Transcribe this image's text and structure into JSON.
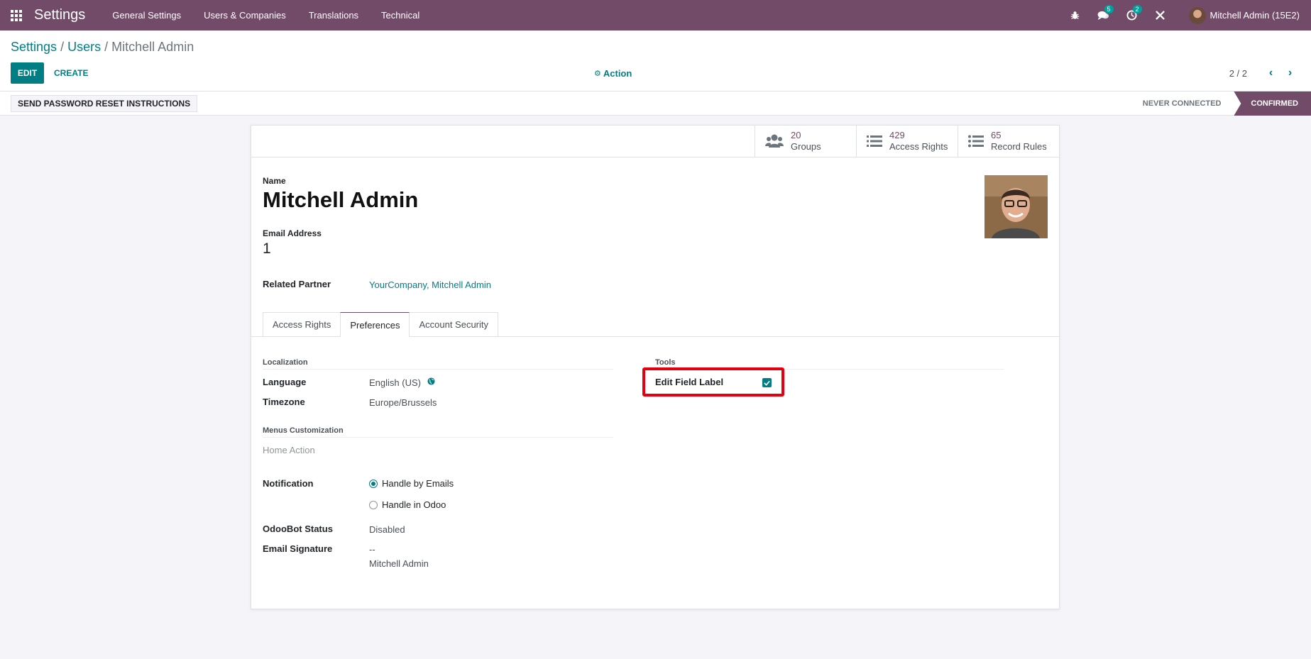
{
  "navbar": {
    "brand": "Settings",
    "menu": [
      "General Settings",
      "Users & Companies",
      "Translations",
      "Technical"
    ],
    "messages_badge": "5",
    "activities_badge": "2",
    "user_name": "Mitchell Admin (15E2)"
  },
  "breadcrumb": {
    "root": "Settings",
    "users": "Users",
    "current": "Mitchell Admin",
    "sep": "/"
  },
  "toolbar": {
    "edit_label": "EDIT",
    "create_label": "CREATE",
    "action_label": "Action"
  },
  "pager": {
    "value": "2 / 2"
  },
  "statusbar": {
    "reset_label": "SEND PASSWORD RESET INSTRUCTIONS",
    "stages": [
      "NEVER CONNECTED",
      "CONFIRMED"
    ]
  },
  "stat_buttons": [
    {
      "value": "20",
      "label": "Groups"
    },
    {
      "value": "429",
      "label": "Access Rights"
    },
    {
      "value": "65",
      "label": "Record Rules"
    }
  ],
  "form": {
    "name_label": "Name",
    "name_value": "Mitchell Admin",
    "email_label": "Email Address",
    "email_value": "1",
    "partner_label": "Related Partner",
    "partner_value": "YourCompany, Mitchell Admin"
  },
  "tabs": [
    "Access Rights",
    "Preferences",
    "Account Security"
  ],
  "preferences": {
    "localization_head": "Localization",
    "language_label": "Language",
    "language_value": "English (US)",
    "timezone_label": "Timezone",
    "timezone_value": "Europe/Brussels",
    "menus_head": "Menus Customization",
    "home_action_placeholder": "Home Action",
    "notification_label": "Notification",
    "notification_options": [
      "Handle by Emails",
      "Handle in Odoo"
    ],
    "odoobot_label": "OdooBot Status",
    "odoobot_value": "Disabled",
    "signature_label": "Email Signature",
    "signature_line1": "--",
    "signature_line2": "Mitchell Admin",
    "tools_head": "Tools",
    "edit_field_label": "Edit Field Label"
  },
  "colors": {
    "brand": "#714b67",
    "accent": "#017e84",
    "highlight": "#e6000f"
  }
}
